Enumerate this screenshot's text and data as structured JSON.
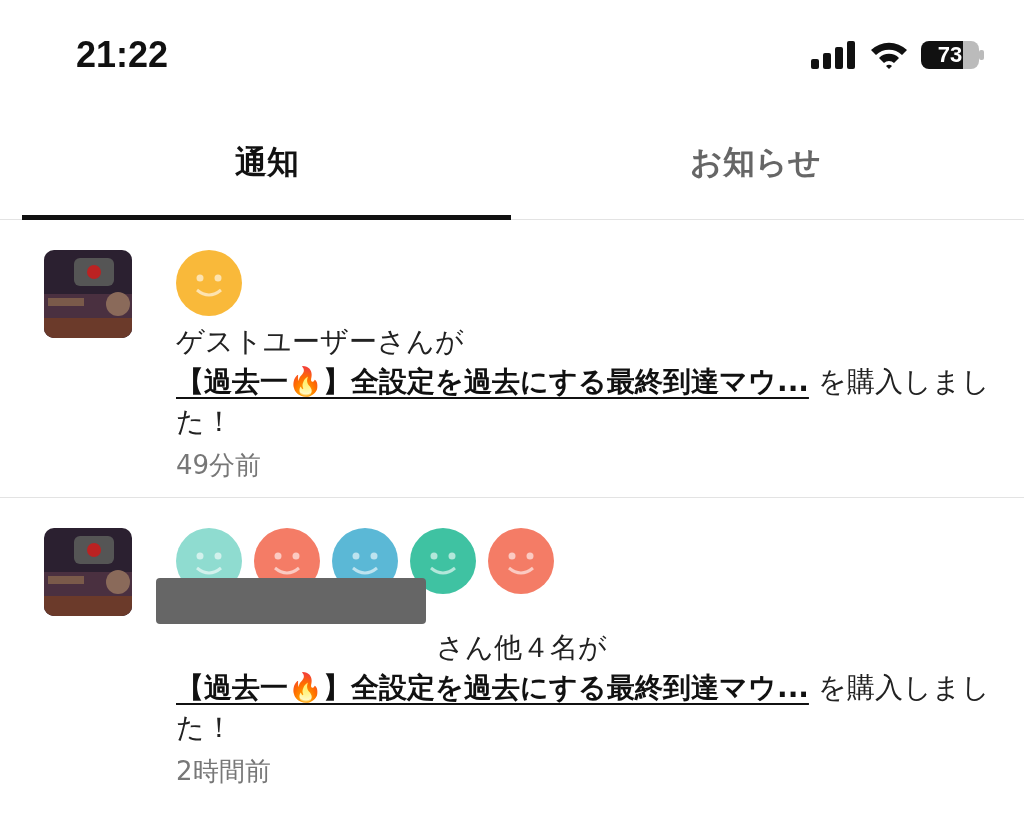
{
  "status_bar": {
    "time": "21:22",
    "battery": "73"
  },
  "tabs": [
    {
      "label": "通知",
      "selected": true
    },
    {
      "label": "お知らせ",
      "selected": false
    }
  ],
  "notifications": [
    {
      "thumbnail": {
        "kind": "picture"
      },
      "avatars": [
        {
          "color": "#f9b93a"
        }
      ],
      "redacted": false,
      "prefix": "ゲストユーザーさんが",
      "link": "【過去一🔥】全設定を過去にする最終到達マウ...",
      "suffix": " を購入しました！",
      "time": "49分前"
    },
    {
      "thumbnail": {
        "kind": "picture"
      },
      "avatars": [
        {
          "color": "#8fdcd0"
        },
        {
          "color": "#f47c66"
        },
        {
          "color": "#5bb8d6"
        },
        {
          "color": "#3fc2a2"
        },
        {
          "color": "#f47c66"
        }
      ],
      "redacted": true,
      "prefix": "さん他４名が",
      "link": "【過去一🔥】全設定を過去にする最終到達マウ...",
      "suffix": " を購入しました！",
      "time": "2時間前"
    }
  ]
}
